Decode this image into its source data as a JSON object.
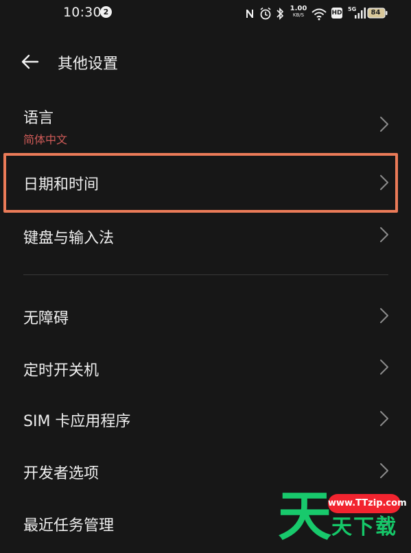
{
  "status_bar": {
    "time": "10:30",
    "notification_count": "2",
    "network_speed": "1.00",
    "network_speed_unit": "KB/S",
    "signal_label": "5G",
    "hd_label": "HD",
    "battery_level": "84"
  },
  "header": {
    "title": "其他设置"
  },
  "settings": {
    "items": [
      {
        "title": "语言",
        "subtitle": "简体中文"
      },
      {
        "title": "日期和时间"
      },
      {
        "title": "键盘与输入法"
      },
      {
        "title": "无障碍"
      },
      {
        "title": "定时开关机"
      },
      {
        "title": "SIM 卡应用程序"
      },
      {
        "title": "开发者选项"
      },
      {
        "title": "最近任务管理"
      }
    ]
  },
  "watermark": {
    "site": "www.TTzip.com",
    "logo_text": "天",
    "brand_text": "天下载"
  },
  "colors": {
    "background": "#171717",
    "accent_subtitle": "#d05b58",
    "highlight_border": "#eb7b58"
  },
  "icons": {
    "back": "arrow-left-icon",
    "chevron": "chevron-right-icon"
  }
}
